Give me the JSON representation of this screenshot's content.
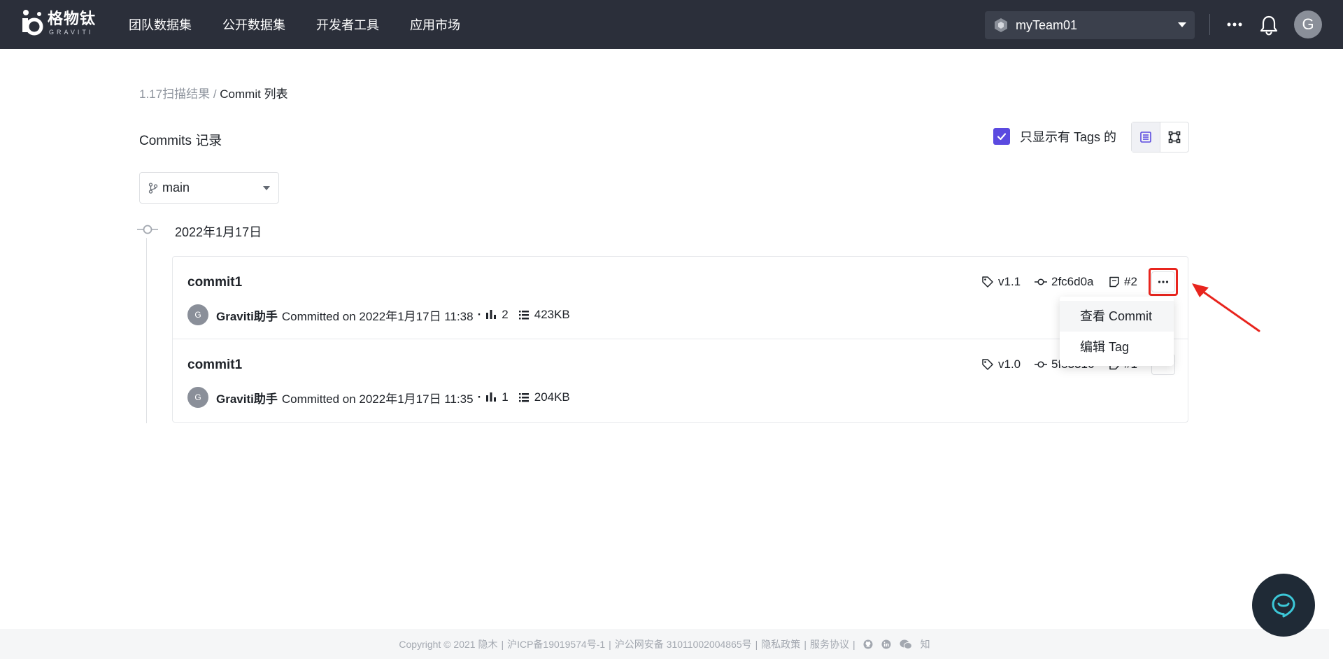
{
  "app": {
    "logo_cn": "格物钛",
    "logo_en": "GRAVITI"
  },
  "nav": {
    "items": [
      "团队数据集",
      "公开数据集",
      "开发者工具",
      "应用市场"
    ]
  },
  "team": {
    "name": "myTeam01"
  },
  "user": {
    "avatar_letter": "G"
  },
  "breadcrumb": {
    "parent": "1.17扫描结果",
    "separator": " / ",
    "current": "Commit 列表"
  },
  "header": {
    "title": "Commits 记录",
    "tags_only_label": "只显示有 Tags 的",
    "tags_only_checked": true
  },
  "branch": {
    "selected": "main"
  },
  "timeline": {
    "date": "2022年1月17日"
  },
  "commits": [
    {
      "title": "commit1",
      "avatar_letter": "G",
      "author": "Graviti助手",
      "committed_text": "Committed on 2022年1月17日 11:38",
      "count": "2",
      "size": "423KB",
      "tag": "v1.1",
      "hash": "2fc6d0a",
      "number": "#2"
    },
    {
      "title": "commit1",
      "avatar_letter": "G",
      "author": "Graviti助手",
      "committed_text": "Committed on 2022年1月17日 11:35",
      "count": "1",
      "size": "204KB",
      "tag": "v1.0",
      "hash": "5f83316",
      "number": "#1"
    }
  ],
  "dropdown": {
    "items": [
      "查看 Commit",
      "编辑 Tag"
    ]
  },
  "footer": {
    "copyright": "Copyright © 2021 隐木",
    "icp": "沪ICP备19019574号-1",
    "police": "沪公网安备 31011002004865号",
    "privacy": "隐私政策",
    "terms": "服务协议",
    "zhihu": "知"
  },
  "colors": {
    "topbar": "#2b2f3a",
    "accent": "#5b4ae0",
    "highlight": "#e8251e"
  }
}
